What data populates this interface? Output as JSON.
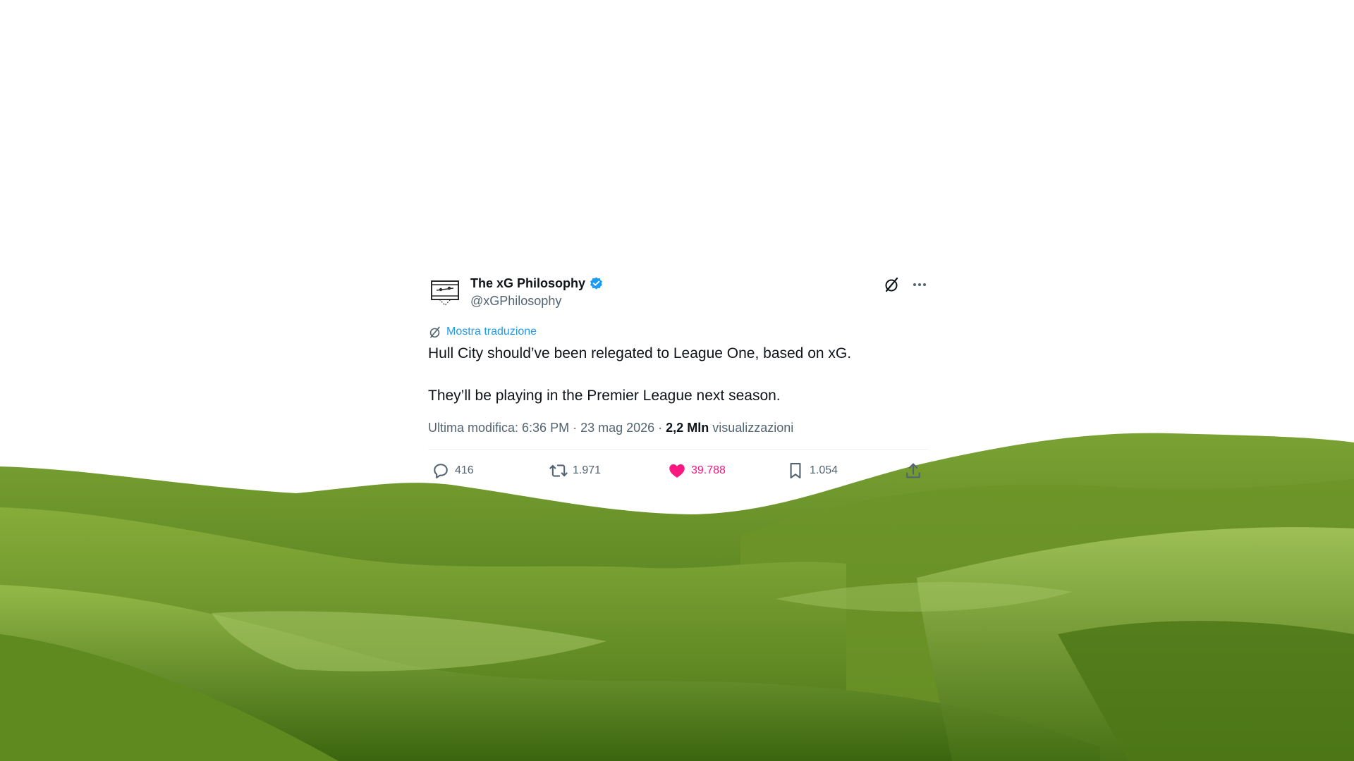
{
  "tweet": {
    "author": {
      "display_name": "The xG Philosophy",
      "handle": "@xGPhilosophy",
      "verified": true,
      "avatar_icon": "football-pitch-avatar-icon"
    },
    "translate_label": "Mostra traduzione",
    "text_paragraphs": [
      "Hull City should’ve been relegated to League One, based on xG.",
      "They’ll be playing in the Premier League next season."
    ],
    "meta": {
      "edited_prefix": "Ultima modifica: ",
      "time": "6:36 PM",
      "separator": " · ",
      "date": "23 mag 2026",
      "views_count": "2,2 Mln",
      "views_label": " visualizzazioni"
    },
    "actions": {
      "reply_count": "416",
      "retweet_count": "1.971",
      "like_count": "39.788",
      "bookmark_count": "1.054"
    },
    "colors": {
      "text": "#0f1419",
      "secondary": "#536471",
      "link": "#1d9bf0",
      "like": "#f91880",
      "verified": "#1d9bf0"
    }
  }
}
